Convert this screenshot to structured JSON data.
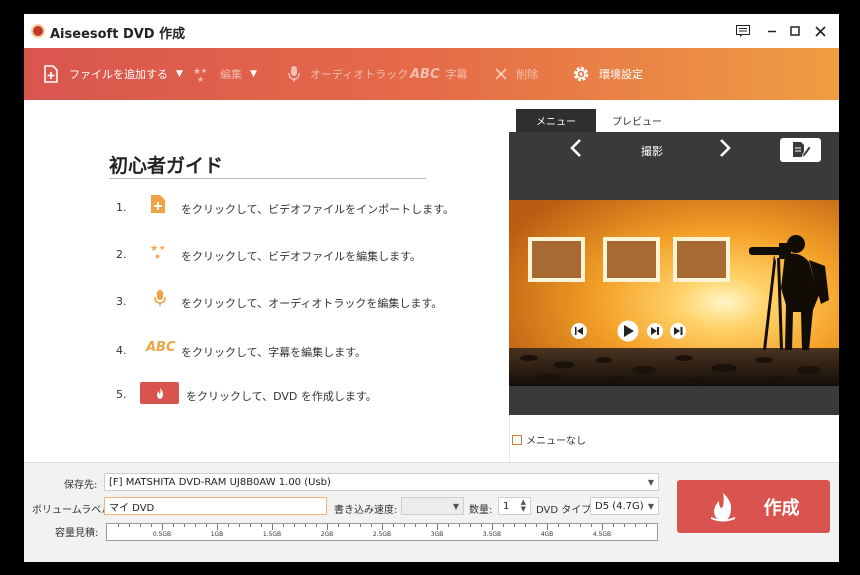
{
  "window": {
    "title": "Aiseesoft DVD 作成"
  },
  "toolbar": {
    "items": [
      {
        "label": "ファイルを追加する",
        "icon": "add-file-icon",
        "enabled": true
      },
      {
        "label": "編集",
        "icon": "edit-stars-icon",
        "enabled": false
      },
      {
        "label": "オーディオトラック",
        "icon": "microphone-icon",
        "enabled": false
      },
      {
        "label": "字幕",
        "icon": "abc-subtitle-icon",
        "icon_text": "ABC",
        "enabled": false
      },
      {
        "label": "削除",
        "icon": "delete-x-icon",
        "enabled": false
      },
      {
        "label": "環境設定",
        "icon": "gear-icon",
        "enabled": true
      }
    ],
    "gradient": [
      "#d9554e",
      "#e56b48",
      "#ef9d43"
    ]
  },
  "guide": {
    "title": "初心者ガイド",
    "steps": [
      {
        "num": "1.",
        "text": "をクリックして、ビデオファイルをインポートします。",
        "icon": "add-file-icon"
      },
      {
        "num": "2.",
        "text": "をクリックして、ビデオファイルを編集します。",
        "icon": "edit-stars-icon"
      },
      {
        "num": "3.",
        "text": "をクリックして、オーディオトラックを編集します。",
        "icon": "microphone-icon"
      },
      {
        "num": "4.",
        "text": "をクリックして、字幕を編集します。",
        "icon": "abc-subtitle-icon",
        "icon_text": "ABC"
      },
      {
        "num": "5.",
        "text": "をクリックして、DVD を作成します。",
        "icon": "create-fire-icon"
      }
    ]
  },
  "preview": {
    "tabs": [
      {
        "label": "メニュー",
        "active": true
      },
      {
        "label": "プレビュー",
        "active": false
      }
    ],
    "theme_name": "撮影",
    "no_menu_label": "メニューなし",
    "no_menu_checked": false
  },
  "bottom": {
    "destination_label": "保存先:",
    "destination_value": "[F] MATSHITA DVD-RAM UJ8B0AW 1.00 (Usb)",
    "volume_label": "ボリュームラベル:",
    "volume_value": "マイ DVD",
    "speed_label": "書き込み速度:",
    "speed_value": "",
    "quantity_label": "数量:",
    "quantity_value": "1",
    "dvd_type_label": "DVD タイプ:",
    "dvd_type_value": "D5 (4.7G)",
    "capacity_label": "容量見積:",
    "capacity_ticks": [
      "0.5GB",
      "1GB",
      "1.5GB",
      "2GB",
      "2.5GB",
      "3GB",
      "3.5GB",
      "4GB",
      "4.5GB"
    ],
    "capacity_used_fraction": 0,
    "create_label": "作成",
    "accent": "#d9534f"
  }
}
